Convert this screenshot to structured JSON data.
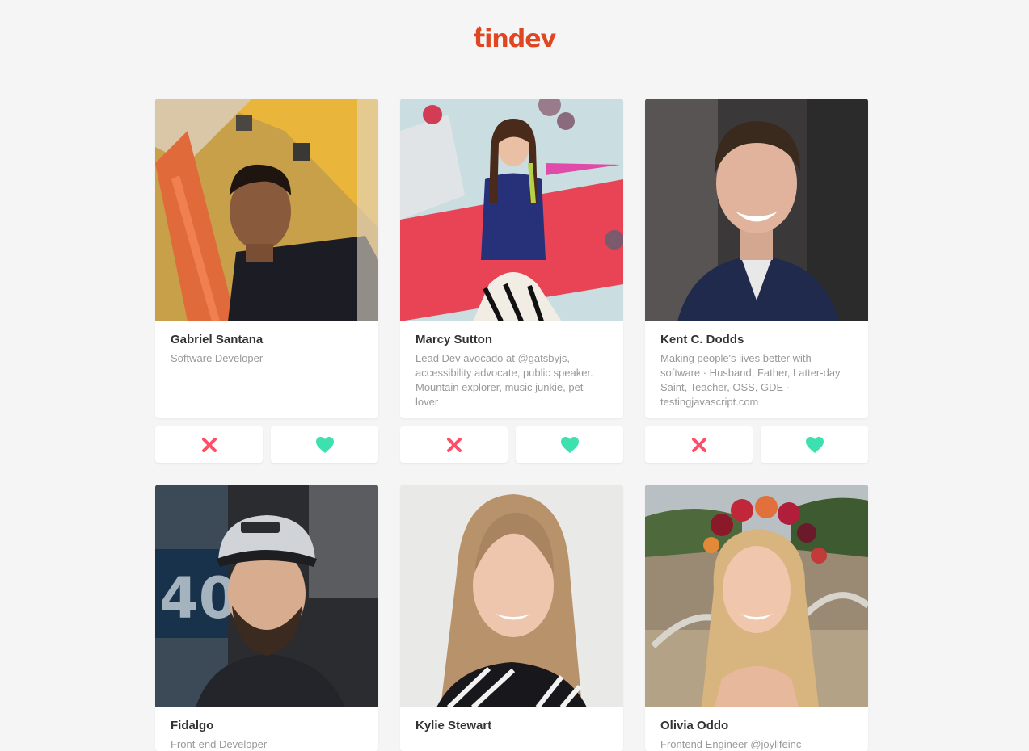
{
  "app": {
    "logo_text": "tindev",
    "brand_color": "#df4723"
  },
  "actions": {
    "dislike_icon": "x-icon",
    "like_icon": "heart-icon",
    "dislike_color": "#fd4f68",
    "like_color": "#3ee0b0"
  },
  "devs": [
    {
      "name": "Gabriel Santana",
      "bio": "Software Developer"
    },
    {
      "name": "Marcy Sutton",
      "bio": "Lead Dev avocado at @gatsbyjs, accessibility advocate, public speaker. Mountain explorer, music junkie, pet lover"
    },
    {
      "name": "Kent C. Dodds",
      "bio": "Making people's lives better with software · Husband, Father, Latter-day Saint, Teacher, OSS, GDE · testingjavascript.com"
    },
    {
      "name": "Fidalgo",
      "bio": "Front-end Developer"
    },
    {
      "name": "Kylie Stewart",
      "bio": ""
    },
    {
      "name": "Olivia Oddo",
      "bio": "Frontend Engineer @joylifeinc"
    }
  ]
}
